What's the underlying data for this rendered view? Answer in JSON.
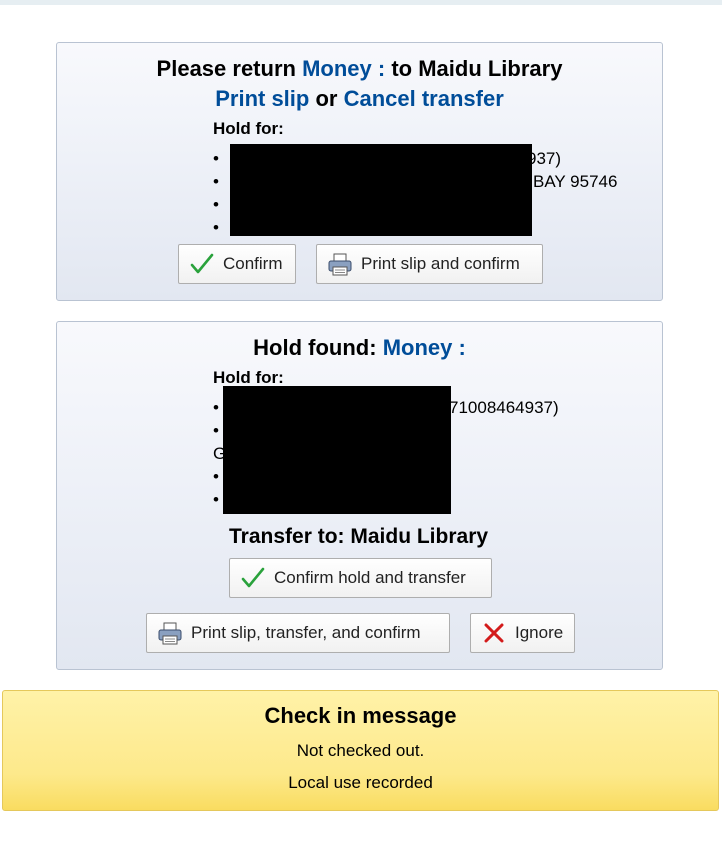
{
  "panel1": {
    "title_prefix": "Please return",
    "item_title": "Money :",
    "title_suffix": "to Maidu Library",
    "print_slip_label": "Print slip",
    "or_text": "or",
    "cancel_transfer_label": "Cancel transfer",
    "hold_for_label": "Hold for:",
    "hold_lines": [
      "937)",
      "BAY 95746",
      "",
      ""
    ],
    "confirm_label": "Confirm",
    "print_confirm_label": "Print slip and confirm"
  },
  "panel2": {
    "title_prefix": "Hold found:",
    "item_title": "Money :",
    "hold_for_label": "Hold for:",
    "hold_lines": [
      "71008464937)",
      "",
      "",
      ""
    ],
    "wrapped_fragment": "G",
    "transfer_to_label": "Transfer to: Maidu Library",
    "confirm_hold_transfer_label": "Confirm hold and transfer",
    "print_transfer_confirm_label": "Print slip, transfer, and confirm",
    "ignore_label": "Ignore"
  },
  "message": {
    "title": "Check in message",
    "lines": [
      "Not checked out.",
      "Local use recorded"
    ]
  },
  "colors": {
    "link": "#004d99",
    "check_icon": "#2aa23c",
    "ignore_icon": "#d31b1b",
    "message_bg": "#fde98b"
  },
  "icons": {
    "confirm": "check-icon",
    "print": "printer-icon",
    "ignore": "x-icon"
  }
}
